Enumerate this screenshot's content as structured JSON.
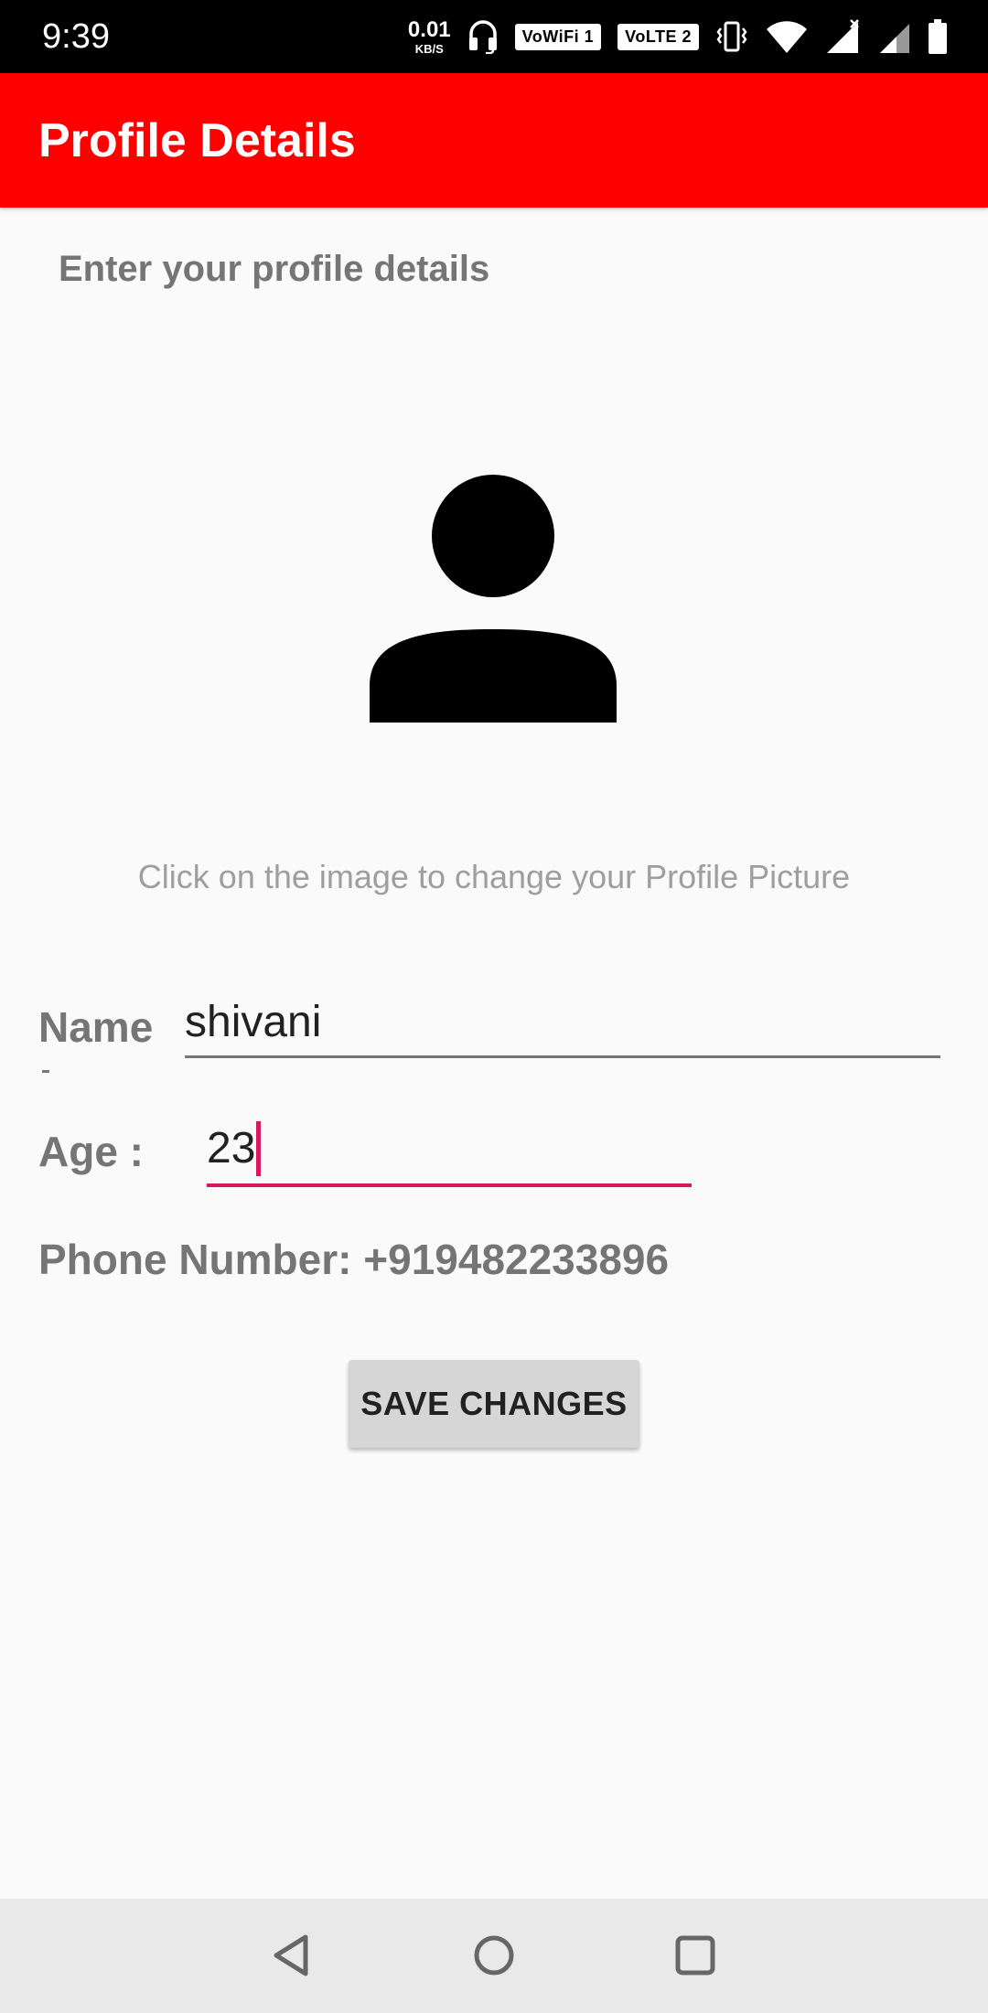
{
  "status_bar": {
    "time": "9:39",
    "speed_value": "0.01",
    "speed_unit": "KB/S",
    "wifi_badge": "VoWiFi 1",
    "lte_badge": "VoLTE 2"
  },
  "app_bar": {
    "title": "Profile Details",
    "color": "#ff0000"
  },
  "content": {
    "subtitle": "Enter your profile details",
    "avatar_icon": "person-icon",
    "hint": "Click on the image to change your Profile Picture",
    "name_label": "Name",
    "name_value": "shivani",
    "age_label": "Age :",
    "age_value": "23",
    "phone_text": "Phone Number: +919482233896",
    "save_label": "SAVE CHANGES",
    "accent_color": "#d81b60"
  },
  "nav_bar": {
    "icons": [
      "back-icon",
      "home-icon",
      "recents-icon"
    ]
  }
}
